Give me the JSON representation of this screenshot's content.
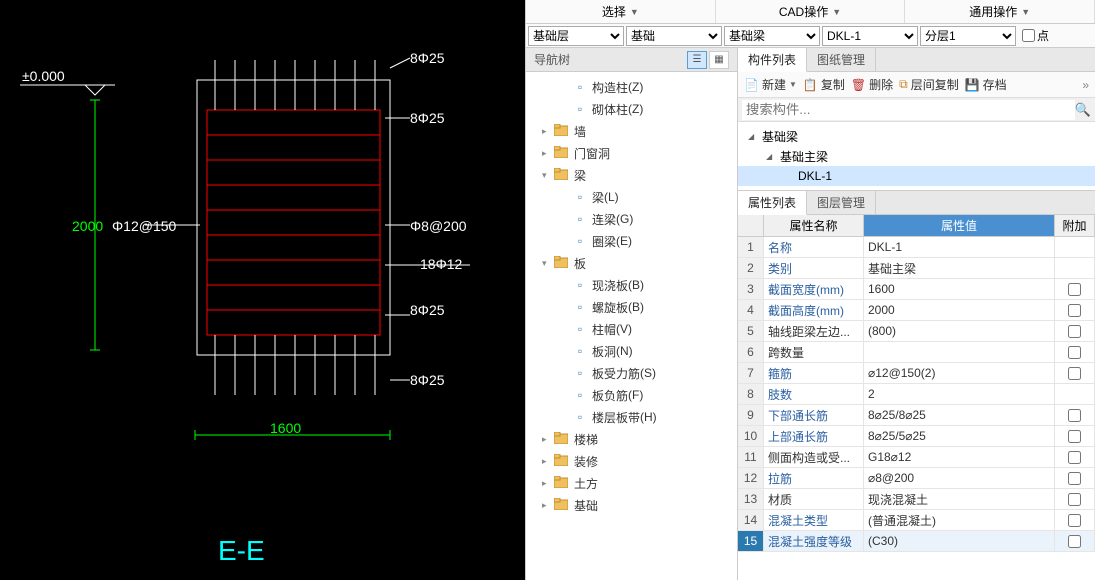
{
  "toolbar": {
    "select": "选择",
    "cad_ops": "CAD操作",
    "common_ops": "通用操作"
  },
  "dropdowns": {
    "floor": "基础层",
    "category": "基础",
    "subcategory": "基础梁",
    "component": "DKL-1",
    "layer": "分层1",
    "point_label": "点"
  },
  "nav_title": "导航树",
  "tree": [
    {
      "type": "item",
      "icon": "blue",
      "label": "构造柱",
      "shortcut": "(Z)"
    },
    {
      "type": "item",
      "icon": "blue",
      "label": "砌体柱",
      "shortcut": "(Z)"
    },
    {
      "type": "folder",
      "label": "墙"
    },
    {
      "type": "folder",
      "label": "门窗洞"
    },
    {
      "type": "folder",
      "label": "梁",
      "open": true
    },
    {
      "type": "item",
      "icon": "blue",
      "label": "梁",
      "shortcut": "(L)"
    },
    {
      "type": "item",
      "icon": "blue",
      "label": "连梁",
      "shortcut": "(G)"
    },
    {
      "type": "item",
      "icon": "blue",
      "label": "圈梁",
      "shortcut": "(E)"
    },
    {
      "type": "folder",
      "label": "板",
      "open": true
    },
    {
      "type": "item",
      "icon": "blue",
      "label": "现浇板",
      "shortcut": "(B)"
    },
    {
      "type": "item",
      "icon": "blue",
      "label": "螺旋板",
      "shortcut": "(B)"
    },
    {
      "type": "item",
      "icon": "blue",
      "label": "柱帽",
      "shortcut": "(V)"
    },
    {
      "type": "item",
      "icon": "blue",
      "label": "板洞",
      "shortcut": "(N)"
    },
    {
      "type": "item",
      "icon": "blue",
      "label": "板受力筋",
      "shortcut": "(S)"
    },
    {
      "type": "item",
      "icon": "blue",
      "label": "板负筋",
      "shortcut": "(F)"
    },
    {
      "type": "item",
      "icon": "blue",
      "label": "楼层板带",
      "shortcut": "(H)"
    },
    {
      "type": "folder",
      "label": "楼梯"
    },
    {
      "type": "folder",
      "label": "装修"
    },
    {
      "type": "folder",
      "label": "土方"
    },
    {
      "type": "folder",
      "label": "基础"
    }
  ],
  "component_list": {
    "tab1": "构件列表",
    "tab2": "图纸管理",
    "actions": {
      "new": "新建",
      "copy": "复制",
      "delete": "删除",
      "layer_copy": "层间复制",
      "save": "存档"
    },
    "search_placeholder": "搜索构件...",
    "tree": [
      {
        "label": "基础梁",
        "depth": 0
      },
      {
        "label": "基础主梁",
        "depth": 1
      },
      {
        "label": "DKL-1",
        "depth": 2,
        "selected": true
      }
    ]
  },
  "prop_list": {
    "tab1": "属性列表",
    "tab2": "图层管理",
    "headers": {
      "name": "属性名称",
      "value": "属性值",
      "extra": "附加"
    },
    "rows": [
      {
        "n": "1",
        "name": "名称",
        "val": "DKL-1",
        "blue": true
      },
      {
        "n": "2",
        "name": "类别",
        "val": "基础主梁",
        "blue": true
      },
      {
        "n": "3",
        "name": "截面宽度(mm)",
        "val": "1600",
        "blue": true,
        "cb": true
      },
      {
        "n": "4",
        "name": "截面高度(mm)",
        "val": "2000",
        "blue": true,
        "cb": true
      },
      {
        "n": "5",
        "name": "轴线距梁左边...",
        "val": "(800)",
        "cb": true
      },
      {
        "n": "6",
        "name": "跨数量",
        "val": "",
        "cb": true
      },
      {
        "n": "7",
        "name": "箍筋",
        "val": "⌀12@150(2)",
        "blue": true,
        "cb": true
      },
      {
        "n": "8",
        "name": "肢数",
        "val": "2",
        "blue": true
      },
      {
        "n": "9",
        "name": "下部通长筋",
        "val": "8⌀25/8⌀25",
        "blue": true,
        "cb": true
      },
      {
        "n": "10",
        "name": "上部通长筋",
        "val": "8⌀25/5⌀25",
        "blue": true,
        "cb": true
      },
      {
        "n": "11",
        "name": "侧面构造或受...",
        "val": "G18⌀12",
        "cb": true
      },
      {
        "n": "12",
        "name": "拉筋",
        "val": "⌀8@200",
        "blue": true,
        "cb": true
      },
      {
        "n": "13",
        "name": "材质",
        "val": "现浇混凝土",
        "cb": true
      },
      {
        "n": "14",
        "name": "混凝土类型",
        "val": "(普通混凝土)",
        "blue": true,
        "cb": true
      },
      {
        "n": "15",
        "name": "混凝土强度等级",
        "val": "(C30)",
        "blue": true,
        "cb": true,
        "selected": true
      }
    ]
  },
  "cad": {
    "elev": "±0.000",
    "dim_v": "2000",
    "dim_h": "1600",
    "rebar1": "Φ12@150",
    "rebar2": "Φ8@200",
    "bar_top1": "8Φ25",
    "bar_top2": "8Φ25",
    "bar_mid": "18Φ12",
    "bar_bot1": "8Φ25",
    "bar_bot2": "8Φ25",
    "section": "E-E"
  }
}
